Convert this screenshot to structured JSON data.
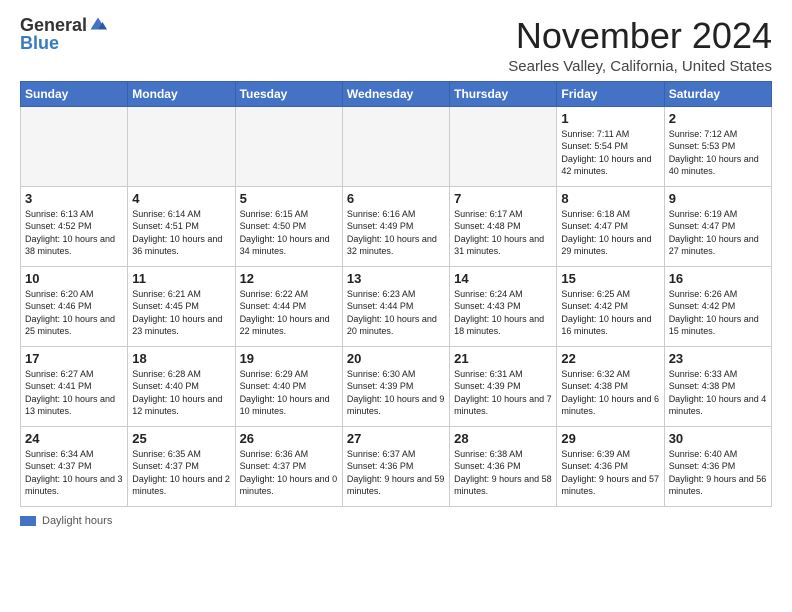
{
  "logo": {
    "general": "General",
    "blue": "Blue",
    "tagline": ""
  },
  "title": "November 2024",
  "location": "Searles Valley, California, United States",
  "headers": [
    "Sunday",
    "Monday",
    "Tuesday",
    "Wednesday",
    "Thursday",
    "Friday",
    "Saturday"
  ],
  "weeks": [
    [
      {
        "day": "",
        "info": ""
      },
      {
        "day": "",
        "info": ""
      },
      {
        "day": "",
        "info": ""
      },
      {
        "day": "",
        "info": ""
      },
      {
        "day": "",
        "info": ""
      },
      {
        "day": "1",
        "info": "Sunrise: 7:11 AM\nSunset: 5:54 PM\nDaylight: 10 hours and 42 minutes."
      },
      {
        "day": "2",
        "info": "Sunrise: 7:12 AM\nSunset: 5:53 PM\nDaylight: 10 hours and 40 minutes."
      }
    ],
    [
      {
        "day": "3",
        "info": "Sunrise: 6:13 AM\nSunset: 4:52 PM\nDaylight: 10 hours and 38 minutes."
      },
      {
        "day": "4",
        "info": "Sunrise: 6:14 AM\nSunset: 4:51 PM\nDaylight: 10 hours and 36 minutes."
      },
      {
        "day": "5",
        "info": "Sunrise: 6:15 AM\nSunset: 4:50 PM\nDaylight: 10 hours and 34 minutes."
      },
      {
        "day": "6",
        "info": "Sunrise: 6:16 AM\nSunset: 4:49 PM\nDaylight: 10 hours and 32 minutes."
      },
      {
        "day": "7",
        "info": "Sunrise: 6:17 AM\nSunset: 4:48 PM\nDaylight: 10 hours and 31 minutes."
      },
      {
        "day": "8",
        "info": "Sunrise: 6:18 AM\nSunset: 4:47 PM\nDaylight: 10 hours and 29 minutes."
      },
      {
        "day": "9",
        "info": "Sunrise: 6:19 AM\nSunset: 4:47 PM\nDaylight: 10 hours and 27 minutes."
      }
    ],
    [
      {
        "day": "10",
        "info": "Sunrise: 6:20 AM\nSunset: 4:46 PM\nDaylight: 10 hours and 25 minutes."
      },
      {
        "day": "11",
        "info": "Sunrise: 6:21 AM\nSunset: 4:45 PM\nDaylight: 10 hours and 23 minutes."
      },
      {
        "day": "12",
        "info": "Sunrise: 6:22 AM\nSunset: 4:44 PM\nDaylight: 10 hours and 22 minutes."
      },
      {
        "day": "13",
        "info": "Sunrise: 6:23 AM\nSunset: 4:44 PM\nDaylight: 10 hours and 20 minutes."
      },
      {
        "day": "14",
        "info": "Sunrise: 6:24 AM\nSunset: 4:43 PM\nDaylight: 10 hours and 18 minutes."
      },
      {
        "day": "15",
        "info": "Sunrise: 6:25 AM\nSunset: 4:42 PM\nDaylight: 10 hours and 16 minutes."
      },
      {
        "day": "16",
        "info": "Sunrise: 6:26 AM\nSunset: 4:42 PM\nDaylight: 10 hours and 15 minutes."
      }
    ],
    [
      {
        "day": "17",
        "info": "Sunrise: 6:27 AM\nSunset: 4:41 PM\nDaylight: 10 hours and 13 minutes."
      },
      {
        "day": "18",
        "info": "Sunrise: 6:28 AM\nSunset: 4:40 PM\nDaylight: 10 hours and 12 minutes."
      },
      {
        "day": "19",
        "info": "Sunrise: 6:29 AM\nSunset: 4:40 PM\nDaylight: 10 hours and 10 minutes."
      },
      {
        "day": "20",
        "info": "Sunrise: 6:30 AM\nSunset: 4:39 PM\nDaylight: 10 hours and 9 minutes."
      },
      {
        "day": "21",
        "info": "Sunrise: 6:31 AM\nSunset: 4:39 PM\nDaylight: 10 hours and 7 minutes."
      },
      {
        "day": "22",
        "info": "Sunrise: 6:32 AM\nSunset: 4:38 PM\nDaylight: 10 hours and 6 minutes."
      },
      {
        "day": "23",
        "info": "Sunrise: 6:33 AM\nSunset: 4:38 PM\nDaylight: 10 hours and 4 minutes."
      }
    ],
    [
      {
        "day": "24",
        "info": "Sunrise: 6:34 AM\nSunset: 4:37 PM\nDaylight: 10 hours and 3 minutes."
      },
      {
        "day": "25",
        "info": "Sunrise: 6:35 AM\nSunset: 4:37 PM\nDaylight: 10 hours and 2 minutes."
      },
      {
        "day": "26",
        "info": "Sunrise: 6:36 AM\nSunset: 4:37 PM\nDaylight: 10 hours and 0 minutes."
      },
      {
        "day": "27",
        "info": "Sunrise: 6:37 AM\nSunset: 4:36 PM\nDaylight: 9 hours and 59 minutes."
      },
      {
        "day": "28",
        "info": "Sunrise: 6:38 AM\nSunset: 4:36 PM\nDaylight: 9 hours and 58 minutes."
      },
      {
        "day": "29",
        "info": "Sunrise: 6:39 AM\nSunset: 4:36 PM\nDaylight: 9 hours and 57 minutes."
      },
      {
        "day": "30",
        "info": "Sunrise: 6:40 AM\nSunset: 4:36 PM\nDaylight: 9 hours and 56 minutes."
      }
    ]
  ],
  "footer": {
    "legend": "Daylight hours"
  }
}
